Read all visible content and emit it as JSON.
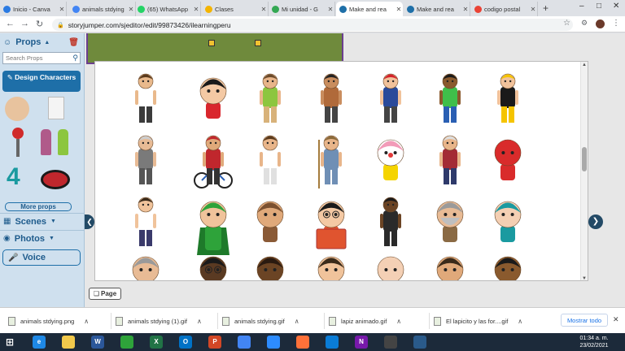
{
  "browser": {
    "tabs": [
      {
        "title": "Inicio - Canva",
        "color": "#2a7ae2",
        "active": false
      },
      {
        "title": "animals stdying",
        "color": "#4285f4",
        "active": false
      },
      {
        "title": "(65) WhatsApp",
        "color": "#25d366",
        "active": false
      },
      {
        "title": "Clases",
        "color": "#f4b400",
        "active": false
      },
      {
        "title": "Mi unidad - G",
        "color": "#34a853",
        "active": false
      },
      {
        "title": "Make and rea",
        "color": "#1e6fa8",
        "active": true
      },
      {
        "title": "Make and rea",
        "color": "#1e6fa8",
        "active": false
      },
      {
        "title": "codigo postal",
        "color": "#ea4335",
        "active": false
      }
    ],
    "new_tab": "+",
    "url": "storyjumper.com/sjeditor/edit/99873426/ilearningperu"
  },
  "editor": {
    "props_title": "Props",
    "search_placeholder": "Search Props",
    "design_characters": "Design Characters",
    "more_props": "More props",
    "scenes": "Scenes",
    "photos": "Photos",
    "voice": "Voice",
    "page_button": "Page",
    "thumb_number": "4"
  },
  "characters": [
    {
      "kind": "man-vest",
      "skin": "#e9b98c",
      "hair": "#5a3a1c",
      "shirt": "#ffffff",
      "pants": "#3b3b3b",
      "accent": "#f2d21b"
    },
    {
      "kind": "boy-big-head",
      "skin": "#f4c9a4",
      "hair": "#1a1a1a",
      "shirt": "#d9262d",
      "pants": "#c8c8c8",
      "accent": "#d9262d"
    },
    {
      "kind": "man-green",
      "skin": "#e8b58a",
      "hair": "#6b4a2b",
      "shirt": "#8cc63f",
      "pants": "#d8b27a",
      "accent": "#8cc63f"
    },
    {
      "kind": "small-kid",
      "skin": "#c98d5e",
      "hair": "#222",
      "shirt": "#b06a3a",
      "pants": "#444",
      "accent": "#b06a3a"
    },
    {
      "kind": "pirate",
      "skin": "#f1c29b",
      "hair": "#d3222a",
      "shirt": "#2a4a9a",
      "pants": "#444",
      "accent": "#d3222a"
    },
    {
      "kind": "kid-waving",
      "skin": "#8a5a2e",
      "hair": "#1a1a1a",
      "shirt": "#3fbf4a",
      "pants": "#2a5fb3",
      "accent": "#3fbf4a"
    },
    {
      "kind": "jester",
      "skin": "#f1c29b",
      "hair": "#f5c400",
      "shirt": "#1a1a1a",
      "pants": "#f5c400",
      "accent": "#f5c400"
    },
    {
      "kind": "old-man",
      "skin": "#e8bb95",
      "hair": "#cccccc",
      "shirt": "#7a7a7a",
      "pants": "#555",
      "accent": "#7a7a7a"
    },
    {
      "kind": "cyclist",
      "skin": "#e0a97a",
      "hair": "#c0272d",
      "shirt": "#c0272d",
      "pants": "#333",
      "accent": "#222"
    },
    {
      "kind": "scientist",
      "skin": "#e8b58a",
      "hair": "#5a3a1c",
      "shirt": "#ffffff",
      "pants": "#e0e0e0",
      "accent": "#2a6fb3"
    },
    {
      "kind": "farmer",
      "skin": "#e8b58a",
      "hair": "#8a6a3a",
      "shirt": "#6f8fb5",
      "pants": "#6f8fb5",
      "accent": "#a57c3d"
    },
    {
      "kind": "clown",
      "skin": "#ffffff",
      "hair": "#f29bb8",
      "shirt": "#f5d400",
      "pants": "#e23a3a",
      "accent": "#e23a3a"
    },
    {
      "kind": "grandpa-red",
      "skin": "#e8b58a",
      "hair": "#dddddd",
      "shirt": "#a32b35",
      "pants": "#2e3a6b",
      "accent": "#a32b35"
    },
    {
      "kind": "red-monster",
      "skin": "#d92b2b",
      "hair": "#d92b2b",
      "shirt": "#d92b2b",
      "pants": "#7a1a1a",
      "accent": "#ffffff"
    },
    {
      "kind": "man-waving",
      "skin": "#f0c39b",
      "hair": "#3a2a1a",
      "shirt": "#ffffff",
      "pants": "#3a3a6b",
      "accent": "#2a6fb3"
    },
    {
      "kind": "superhero",
      "skin": "#f0c39b",
      "hair": "#2ea33a",
      "shirt": "#2ea33a",
      "pants": "#2ea33a",
      "accent": "#ffffff"
    },
    {
      "kind": "caveman",
      "skin": "#e0a97a",
      "hair": "#7a5030",
      "shirt": "#8a5a36",
      "pants": "#8a5a36",
      "accent": "#8a5a36"
    },
    {
      "kind": "reader",
      "skin": "#f4c9a4",
      "hair": "#1a1a1a",
      "shirt": "#e0542f",
      "pants": "#c0402a",
      "accent": "#e0542f"
    },
    {
      "kind": "suit-man",
      "skin": "#6b4424",
      "hair": "#1a1a1a",
      "shirt": "#2a2a2a",
      "pants": "#2a2a2a",
      "accent": "#ffffff"
    },
    {
      "kind": "bearded-man",
      "skin": "#e8bb95",
      "hair": "#9a9a9a",
      "shirt": "#8a6a44",
      "pants": "#8a6a44",
      "accent": "#9a9a9a"
    },
    {
      "kind": "teal-hair",
      "skin": "#f4cfb3",
      "hair": "#1a9aa0",
      "shirt": "#1a9aa0",
      "pants": "#1a9aa0",
      "accent": "#1a9aa0"
    },
    {
      "kind": "bald-head",
      "skin": "#e8bb95",
      "hair": "#9a9a9a",
      "shirt": "#777",
      "pants": "#777",
      "accent": "#777"
    },
    {
      "kind": "girl-glasses",
      "skin": "#5a3a22",
      "hair": "#1a1a1a",
      "shirt": "#2ea3a3",
      "pants": "#2ea3a3",
      "accent": "#2ea3a3"
    },
    {
      "kind": "brown-head",
      "skin": "#6b4424",
      "hair": "#2a1a10",
      "shirt": "#5a3a22",
      "pants": "#5a3a22",
      "accent": "#5a3a22"
    },
    {
      "kind": "man-tie",
      "skin": "#f0c39b",
      "hair": "#3a2a1a",
      "shirt": "#2a4a8a",
      "pants": "#2a4a8a",
      "accent": "#d3222a"
    },
    {
      "kind": "bald-kid",
      "skin": "#f4d0b5",
      "hair": "#f4d0b5",
      "shirt": "#ddd",
      "pants": "#ddd",
      "accent": "#ddd"
    },
    {
      "kind": "long-hair",
      "skin": "#e0a97a",
      "hair": "#3a2a1a",
      "shirt": "#3a2a1a",
      "pants": "#3a2a1a",
      "accent": "#3a2a1a"
    },
    {
      "kind": "kid-brown",
      "skin": "#8a5a2e",
      "hair": "#1a1a1a",
      "shirt": "#e0542f",
      "pants": "#e0542f",
      "accent": "#e0542f"
    }
  ],
  "downloads": [
    {
      "name": "animals stdying.png"
    },
    {
      "name": "animals stdying (1).gif"
    },
    {
      "name": "animals stdying.gif"
    },
    {
      "name": "lapiz animado.gif"
    },
    {
      "name": "El lapicito y las for....gif"
    }
  ],
  "show_all": "Mostrar todo",
  "taskbar": {
    "time": "01:34 a. m.",
    "date": "23/02/2021",
    "apps": [
      {
        "label": "e",
        "color": "#1e88e5"
      },
      {
        "label": "",
        "color": "#f2c94c"
      },
      {
        "label": "W",
        "color": "#2b579a"
      },
      {
        "label": "",
        "color": "#2ea33a"
      },
      {
        "label": "X",
        "color": "#217346"
      },
      {
        "label": "O",
        "color": "#0072c6"
      },
      {
        "label": "P",
        "color": "#d24726"
      },
      {
        "label": "",
        "color": "#4285f4"
      },
      {
        "label": "",
        "color": "#2d8cff"
      },
      {
        "label": "",
        "color": "#ff7139"
      },
      {
        "label": "",
        "color": "#0a7cd6"
      },
      {
        "label": "N",
        "color": "#7719aa"
      },
      {
        "label": "",
        "color": "#444"
      },
      {
        "label": "",
        "color": "#2a5a8a"
      }
    ]
  }
}
